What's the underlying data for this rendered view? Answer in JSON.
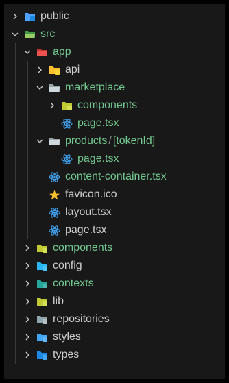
{
  "explorer": {
    "items": [
      {
        "label": "public",
        "type": "folder",
        "icon": "folder-public-icon",
        "iconColor": "#4da3ff",
        "accent": "#1e88e5",
        "expanded": false,
        "depth": 0,
        "label_color": "#cccccc"
      },
      {
        "label": "src",
        "type": "folder",
        "icon": "folder-src-icon",
        "iconColor": "#4caf50",
        "accent": "#9ccc65",
        "expanded": true,
        "depth": 0,
        "label_color": "#73c991"
      },
      {
        "label": "app",
        "type": "folder",
        "icon": "folder-app-icon",
        "iconColor": "#e53935",
        "accent": "#ef5350",
        "expanded": true,
        "depth": 1,
        "label_color": "#73c991"
      },
      {
        "label": "api",
        "type": "folder",
        "icon": "folder-api-icon",
        "iconColor": "#fbc02d",
        "accent": "#fdd835",
        "expanded": false,
        "depth": 2,
        "label_color": "#cccccc"
      },
      {
        "label": "marketplace",
        "type": "folder",
        "icon": "folder-open-icon",
        "iconColor": "#b0bec5",
        "accent": "#cfd8dc",
        "expanded": true,
        "depth": 2,
        "label_color": "#73c991"
      },
      {
        "label": "components",
        "type": "folder",
        "icon": "folder-components-icon",
        "iconColor": "#c0ca33",
        "accent": "#d4e157",
        "expanded": false,
        "depth": 3,
        "label_color": "#73c991"
      },
      {
        "label": "page.tsx",
        "type": "file",
        "icon": "react-icon",
        "iconColor": "#42a5f5",
        "depth": 3,
        "label_color": "#73c991"
      },
      {
        "label": "products",
        "label_sep": "/",
        "label_rest": "[tokenId]",
        "type": "folder",
        "icon": "folder-open-icon",
        "iconColor": "#b0bec5",
        "accent": "#cfd8dc",
        "expanded": true,
        "depth": 2,
        "label_color": "#73c991"
      },
      {
        "label": "page.tsx",
        "type": "file",
        "icon": "react-icon",
        "iconColor": "#42a5f5",
        "depth": 3,
        "label_color": "#73c991"
      },
      {
        "label": "content-container.tsx",
        "type": "file",
        "icon": "react-icon",
        "iconColor": "#42a5f5",
        "depth": 2,
        "label_color": "#73c991"
      },
      {
        "label": "favicon.ico",
        "type": "file",
        "icon": "star-icon",
        "iconColor": "#fbc02d",
        "depth": 2,
        "label_color": "#cccccc"
      },
      {
        "label": "layout.tsx",
        "type": "file",
        "icon": "react-icon",
        "iconColor": "#42a5f5",
        "depth": 2,
        "label_color": "#cccccc"
      },
      {
        "label": "page.tsx",
        "type": "file",
        "icon": "react-icon",
        "iconColor": "#42a5f5",
        "depth": 2,
        "label_color": "#cccccc"
      },
      {
        "label": "components",
        "type": "folder",
        "icon": "folder-components-icon",
        "iconColor": "#c0ca33",
        "accent": "#d4e157",
        "expanded": false,
        "depth": 1,
        "label_color": "#73c991"
      },
      {
        "label": "config",
        "type": "folder",
        "icon": "folder-config-icon",
        "iconColor": "#29b6f6",
        "accent": "#4fc3f7",
        "expanded": false,
        "depth": 1,
        "label_color": "#cccccc"
      },
      {
        "label": "contexts",
        "type": "folder",
        "icon": "folder-contexts-icon",
        "iconColor": "#26a69a",
        "accent": "#4db6ac",
        "expanded": false,
        "depth": 1,
        "label_color": "#73c991"
      },
      {
        "label": "lib",
        "type": "folder",
        "icon": "folder-lib-icon",
        "iconColor": "#c0ca33",
        "accent": "#d4e157",
        "expanded": false,
        "depth": 1,
        "label_color": "#cccccc"
      },
      {
        "label": "repositories",
        "type": "folder",
        "icon": "folder-icon",
        "iconColor": "#90a4ae",
        "accent": "#b0bec5",
        "expanded": false,
        "depth": 1,
        "label_color": "#cccccc"
      },
      {
        "label": "styles",
        "type": "folder",
        "icon": "folder-styles-icon",
        "iconColor": "#42a5f5",
        "accent": "#64b5f6",
        "expanded": false,
        "depth": 1,
        "label_color": "#cccccc"
      },
      {
        "label": "types",
        "type": "folder",
        "icon": "folder-types-icon",
        "iconColor": "#1e88e5",
        "accent": "#42a5f5",
        "expanded": false,
        "depth": 1,
        "label_color": "#cccccc"
      }
    ]
  }
}
